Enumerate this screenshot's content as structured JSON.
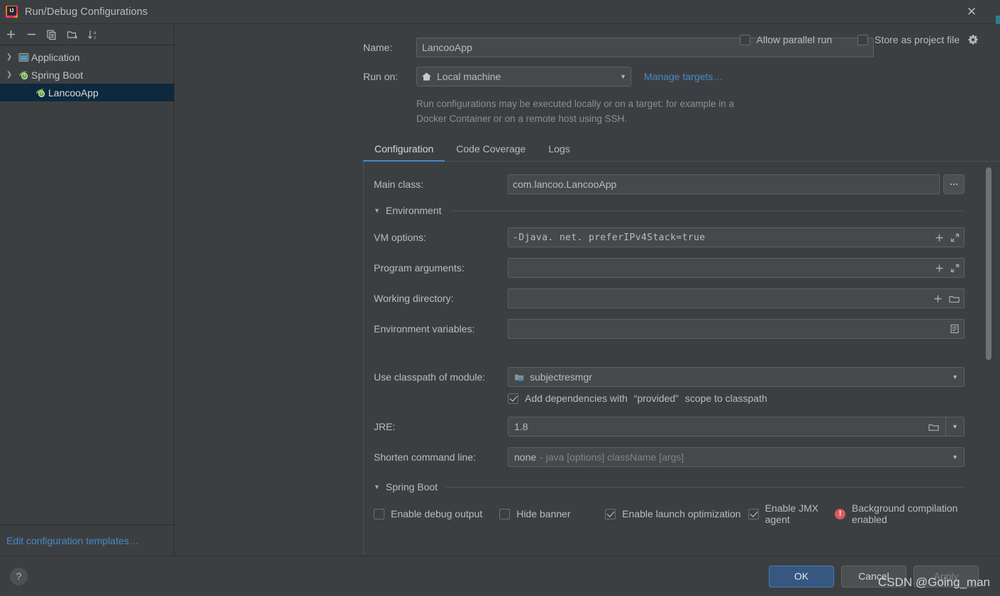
{
  "window": {
    "title": "Run/Debug Configurations",
    "close_label": "✕",
    "logo_name": "intellij-idea-logo"
  },
  "sidebar": {
    "toolbar": [
      {
        "name": "add-configuration-button",
        "icon": "plus-icon",
        "tooltip": "Add New Configuration"
      },
      {
        "name": "remove-configuration-button",
        "icon": "minus-icon",
        "tooltip": "Remove Configuration"
      },
      {
        "name": "copy-configuration-button",
        "icon": "copy-icon",
        "tooltip": "Copy Configuration"
      },
      {
        "name": "new-folder-button",
        "icon": "new-folder-icon",
        "tooltip": "Create New Folder"
      },
      {
        "name": "sort-configurations-button",
        "icon": "sort-az-icon",
        "tooltip": "Sort Configurations"
      }
    ],
    "tree": [
      {
        "label": "Application",
        "level": 0,
        "expanded": false,
        "selected": false,
        "icon": "application-icon"
      },
      {
        "label": "Spring Boot",
        "level": 0,
        "expanded": true,
        "selected": false,
        "icon": "spring-boot-icon"
      },
      {
        "label": "LancooApp",
        "level": 1,
        "expanded": null,
        "selected": true,
        "icon": "spring-boot-icon"
      }
    ],
    "edit_templates_link": "Edit configuration templates…"
  },
  "form": {
    "name_label": "Name:",
    "name_value": "LancooApp",
    "run_on_label": "Run on:",
    "run_on_value": "Local machine",
    "run_on_icon": "home-icon",
    "manage_targets_link": "Manage targets…",
    "description": "Run configurations may be executed locally or on a target: for example in a Docker Container or on a remote host using SSH.",
    "allow_parallel_run": {
      "label": "Allow parallel run",
      "checked": false
    },
    "store_as_project_file": {
      "label": "Store as project file",
      "checked": false,
      "gear_icon": "gear-icon"
    }
  },
  "tabs": [
    {
      "label": "Configuration",
      "active": true
    },
    {
      "label": "Code Coverage",
      "active": false
    },
    {
      "label": "Logs",
      "active": false
    }
  ],
  "configuration": {
    "main_class": {
      "label": "Main class:",
      "value": "com.lancoo.LancooApp",
      "browse_label": "…"
    },
    "environment_section": {
      "title": "Environment",
      "expanded": true
    },
    "vm_options": {
      "label": "VM options:",
      "value": "-Djava. net. preferIPv4Stack=true",
      "icons": [
        "plus-icon",
        "expand-icon"
      ]
    },
    "program_arguments": {
      "label": "Program arguments:",
      "value": "",
      "icons": [
        "plus-icon",
        "expand-icon"
      ]
    },
    "working_directory": {
      "label": "Working directory:",
      "value": "",
      "icons": [
        "plus-icon",
        "folder-icon"
      ]
    },
    "environment_variables": {
      "label": "Environment variables:",
      "value": "",
      "icons": [
        "list-icon"
      ]
    },
    "use_classpath_of_module": {
      "label": "Use classpath of module:",
      "value": "subjectresmgr",
      "icon": "module-icon"
    },
    "add_provided_dependencies": {
      "label_pre": "Add dependencies with",
      "label_quoted": "“provided”",
      "label_post": "scope to classpath",
      "checked": true
    },
    "jre": {
      "label": "JRE:",
      "value": "1.8",
      "folder_icon": "folder-icon"
    },
    "shorten_command_line": {
      "label": "Shorten command line:",
      "value_bold": "none",
      "value_rest": "- java [options] className [args]"
    },
    "spring_boot_section": {
      "title": "Spring Boot",
      "expanded": true,
      "options": [
        {
          "label": "Enable debug output",
          "checked": false
        },
        {
          "label": "Hide banner",
          "checked": false
        },
        {
          "label": "Enable launch optimization",
          "checked": true
        },
        {
          "label": "Enable JMX agent",
          "checked": true
        }
      ],
      "status": {
        "label": "Background compilation enabled",
        "icon": "error-icon",
        "color": "#db5860"
      }
    }
  },
  "footer": {
    "help_label": "?",
    "buttons": [
      {
        "label": "OK",
        "style": "primary"
      },
      {
        "label": "Cancel",
        "style": "default"
      },
      {
        "label": "Apply",
        "style": "disabled"
      }
    ]
  },
  "watermark": "CSDN @Going_man",
  "colors": {
    "background": "#3c3f41",
    "field": "#45494a",
    "accent": "#4a88c7",
    "selection": "#0d293e",
    "primary_button": "#365880",
    "error": "#db5860",
    "spring_green": "#6cab3b"
  }
}
